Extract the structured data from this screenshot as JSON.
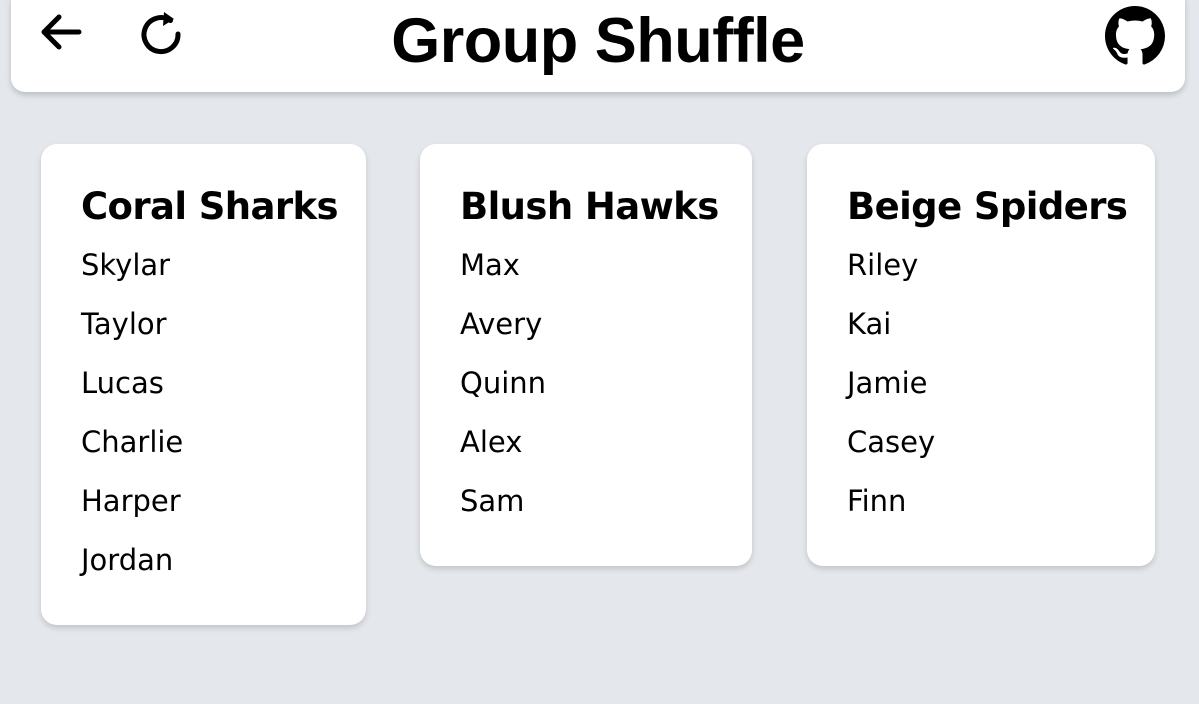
{
  "header": {
    "title": "Group Shuffle",
    "back_icon": "arrow-left-icon",
    "reload_icon": "reload-icon",
    "github_icon": "github-icon"
  },
  "colors": {
    "background": "#e4e7eb",
    "card": "#ffffff",
    "text": "#000000"
  },
  "groups": [
    {
      "name": "Coral Sharks",
      "members": [
        "Skylar",
        "Taylor",
        "Lucas",
        "Charlie",
        "Harper",
        "Jordan"
      ]
    },
    {
      "name": "Blush Hawks",
      "members": [
        "Max",
        "Avery",
        "Quinn",
        "Alex",
        "Sam"
      ]
    },
    {
      "name": "Beige Spiders",
      "members": [
        "Riley",
        "Kai",
        "Jamie",
        "Casey",
        "Finn"
      ]
    }
  ]
}
